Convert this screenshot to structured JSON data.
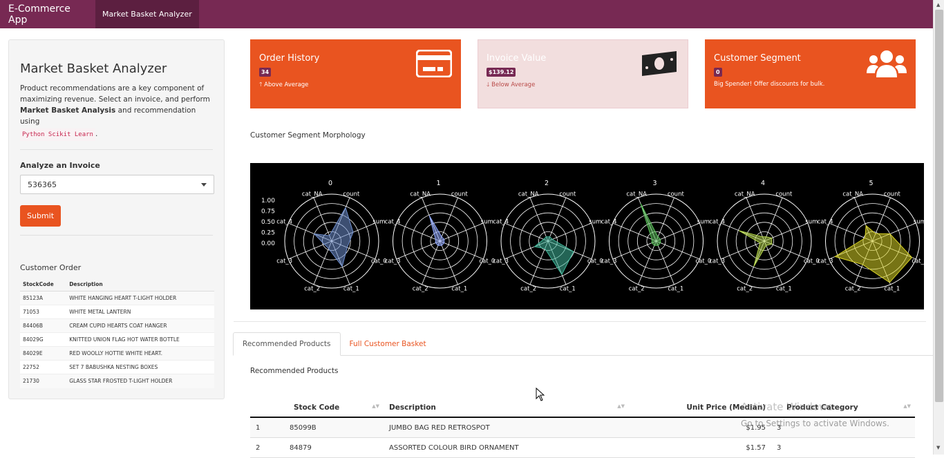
{
  "navbar": {
    "brand": "E-Commerce App",
    "active_tab": "Market Basket Analyzer"
  },
  "sidebar": {
    "title": "Market Basket Analyzer",
    "desc_part1": "Product recommendations are a key component of maximizing revenue. Select an invoice, and perform ",
    "desc_bold": "Market Basket Analysis",
    "desc_part2": " and recommendation using",
    "code": "Python Scikit Learn",
    "code_suffix": ".",
    "form_label": "Analyze an Invoice",
    "select_value": "536365",
    "submit_label": "Submit",
    "order_title": "Customer Order",
    "order_columns": [
      "StockCode",
      "Description"
    ],
    "order_rows": [
      [
        "85123A",
        "WHITE HANGING HEART T-LIGHT HOLDER"
      ],
      [
        "71053",
        "WHITE METAL LANTERN"
      ],
      [
        "84406B",
        "CREAM CUPID HEARTS COAT HANGER"
      ],
      [
        "84029G",
        "KNITTED UNION FLAG HOT WATER BOTTLE"
      ],
      [
        "84029E",
        "RED WOOLLY HOTTIE WHITE HEART."
      ],
      [
        "22752",
        "SET 7 BABUSHKA NESTING BOXES"
      ],
      [
        "21730",
        "GLASS STAR FROSTED T-LIGHT HOLDER"
      ]
    ]
  },
  "cards": {
    "order_history": {
      "title": "Order History",
      "badge": "34",
      "sub": "Above Average",
      "icon": "credit-card-icon"
    },
    "invoice_value": {
      "title": "Invoice Value",
      "badge": "$139.12",
      "sub": "Below Average",
      "icon": "money-bill-icon"
    },
    "customer_segment": {
      "title": "Customer Segment",
      "badge": "0",
      "sub": "Big Spender! Offer discounts for bulk.",
      "icon": "users-icon"
    }
  },
  "morphology_title": "Customer Segment Morphology",
  "chart_data": {
    "type": "radar",
    "axes": [
      "count",
      "sum",
      "cat_0",
      "cat_1",
      "cat_2",
      "cat_3",
      "cat_4",
      "cat_NA"
    ],
    "radial_ticks": [
      "1.00",
      "0.75",
      "0.50",
      "0.25",
      "0.00"
    ],
    "radial_range": [
      0,
      1
    ],
    "panels": [
      {
        "title": "0",
        "color": "#6f8fcf",
        "values": [
          0.75,
          0.45,
          0.3,
          0.55,
          0.1,
          0.1,
          0.35,
          0.05
        ]
      },
      {
        "title": "1",
        "color": "#8fa8ff",
        "values": [
          0.02,
          0.02,
          0.02,
          0.02,
          0.02,
          0.02,
          0.02,
          0.55
        ]
      },
      {
        "title": "2",
        "color": "#3fb79a",
        "values": [
          0.02,
          0.02,
          0.55,
          0.75,
          0.1,
          0.25,
          0.02,
          0.02
        ]
      },
      {
        "title": "3",
        "color": "#5cc35c",
        "values": [
          0.02,
          0.02,
          0.02,
          0.02,
          0.02,
          0.02,
          0.02,
          0.85
        ]
      },
      {
        "title": "4",
        "color": "#b5d64a",
        "values": [
          0.02,
          0.1,
          0.1,
          0.02,
          0.55,
          0.02,
          0.55,
          0.02
        ]
      },
      {
        "title": "5",
        "color": "#d9d326",
        "values": [
          0.1,
          0.35,
          0.9,
          0.95,
          0.5,
          0.85,
          0.1,
          0.3
        ]
      }
    ]
  },
  "tabs": [
    "Recommended Products",
    "Full Customer Basket"
  ],
  "recommended": {
    "title": "Recommended Products",
    "columns": [
      "Stock Code",
      "Description",
      "Unit Price (Median)",
      "Product Category"
    ],
    "rows": [
      [
        "1",
        "85099B",
        "JUMBO BAG RED RETROSPOT",
        "$1.95",
        "3"
      ],
      [
        "2",
        "84879",
        "ASSORTED COLOUR BIRD ORNAMENT",
        "$1.57",
        "3"
      ]
    ]
  },
  "watermark": {
    "line1": "Activate Windows",
    "line2": "Go to Settings to activate Windows."
  }
}
